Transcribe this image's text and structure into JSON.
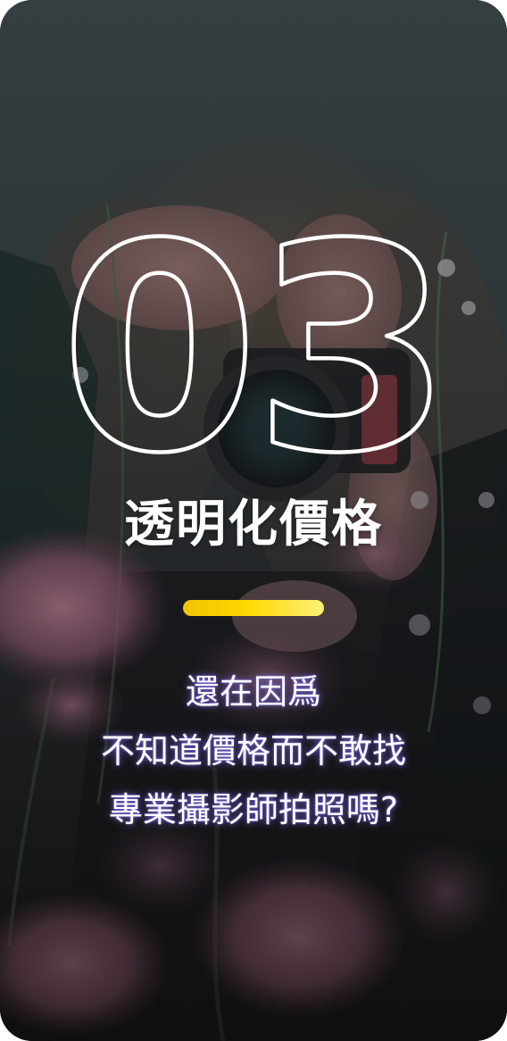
{
  "feature": {
    "number": "03",
    "title": "透明化價格",
    "lines": [
      "還在因爲",
      "不知道價格而不敢找",
      "專業攝影師拍照嗎?"
    ]
  },
  "colors": {
    "accent": "#FFD900",
    "text": "#FFFFFF",
    "glow": "#8C78FF",
    "background": "#2A3133"
  }
}
